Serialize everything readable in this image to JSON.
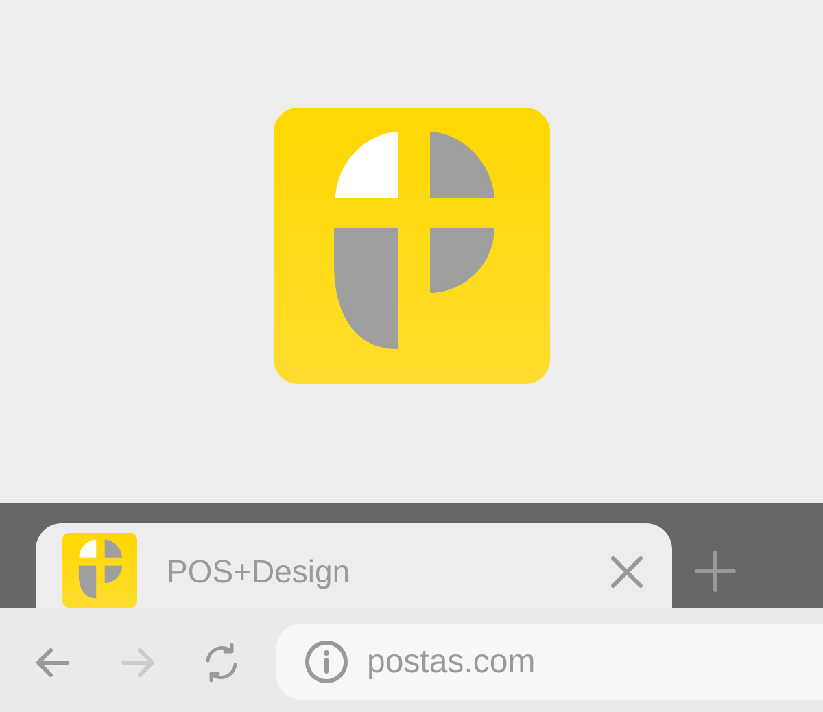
{
  "colors": {
    "background": "#ededed",
    "tab_strip": "#666666",
    "logo_yellow_top": "#ffd700",
    "logo_yellow_bottom": "#ffdd2e",
    "logo_gray": "#9f9f9f",
    "icon_gray": "#999999",
    "icon_disabled": "#cccccc",
    "omnibox": "#f7f7f7"
  },
  "hero": {
    "logo_icon": "pos-design-logo-icon"
  },
  "tab": {
    "title": "POS+Design",
    "favicon_icon": "pos-design-logo-icon",
    "close_icon": "close-icon"
  },
  "new_tab": {
    "icon": "plus-icon"
  },
  "toolbar": {
    "back_icon": "arrow-left-icon",
    "forward_icon": "arrow-right-icon",
    "forward_enabled": false,
    "reload_icon": "reload-icon",
    "site_info_icon": "info-icon",
    "url": "postas.com"
  }
}
